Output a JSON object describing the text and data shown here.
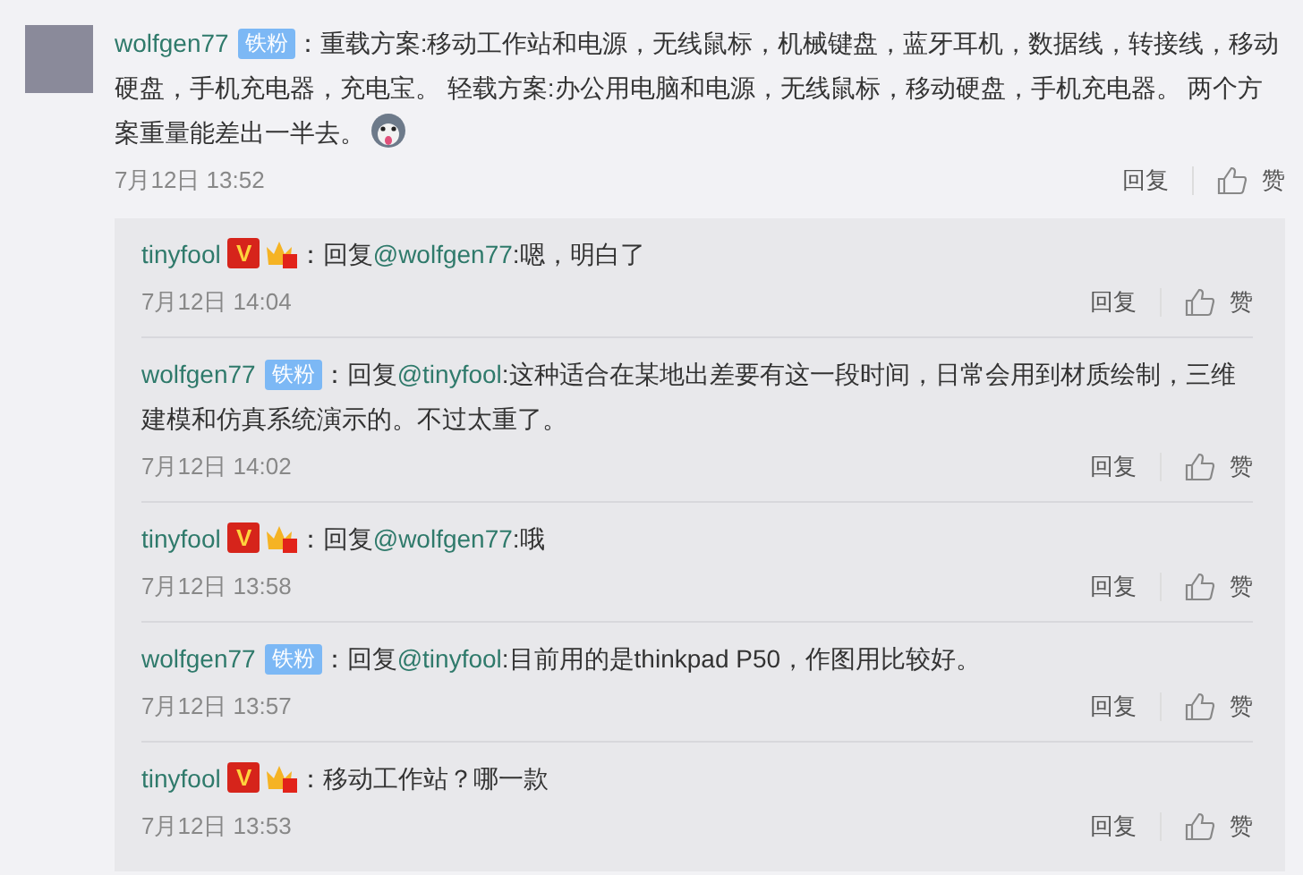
{
  "comment": {
    "user": "wolfgen77",
    "badges": [
      {
        "kind": "fan",
        "label": "铁粉"
      }
    ],
    "segments": [
      {
        "kind": "plain",
        "text": "：重载方案:移动工作站和电源，无线鼠标，机械键盘，蓝牙耳机，数据线，转接线，移动硬盘，手机充电器，充电宝。 轻载方案:办公用电脑和电源，无线鼠标，移动硬盘，手机充电器。 两个方案重量能差出一半去。"
      }
    ],
    "emoji": true,
    "time": "7月12日 13:52",
    "reply": "回复",
    "like": "赞"
  },
  "replies": [
    {
      "user": "tinyfool",
      "badges": [
        {
          "kind": "verified",
          "label": "V"
        },
        {
          "kind": "crown"
        }
      ],
      "segments": [
        {
          "kind": "plain",
          "text": "：回复"
        },
        {
          "kind": "mention",
          "text": "@wolfgen77"
        },
        {
          "kind": "plain",
          "text": ":嗯，明白了"
        }
      ],
      "time": "7月12日 14:04",
      "reply": "回复",
      "like": "赞"
    },
    {
      "user": "wolfgen77",
      "badges": [
        {
          "kind": "fan",
          "label": "铁粉"
        }
      ],
      "segments": [
        {
          "kind": "plain",
          "text": "：回复"
        },
        {
          "kind": "mention",
          "text": "@tinyfool"
        },
        {
          "kind": "plain",
          "text": ":这种适合在某地出差要有这一段时间，日常会用到材质绘制，三维建模和仿真系统演示的。不过太重了。"
        }
      ],
      "time": "7月12日 14:02",
      "reply": "回复",
      "like": "赞"
    },
    {
      "user": "tinyfool",
      "badges": [
        {
          "kind": "verified",
          "label": "V"
        },
        {
          "kind": "crown"
        }
      ],
      "segments": [
        {
          "kind": "plain",
          "text": "：回复"
        },
        {
          "kind": "mention",
          "text": "@wolfgen77"
        },
        {
          "kind": "plain",
          "text": ":哦"
        }
      ],
      "time": "7月12日 13:58",
      "reply": "回复",
      "like": "赞"
    },
    {
      "user": "wolfgen77",
      "badges": [
        {
          "kind": "fan",
          "label": "铁粉"
        }
      ],
      "segments": [
        {
          "kind": "plain",
          "text": "：回复"
        },
        {
          "kind": "mention",
          "text": "@tinyfool"
        },
        {
          "kind": "plain",
          "text": ":目前用的是thinkpad P50，作图用比较好。"
        }
      ],
      "time": "7月12日 13:57",
      "reply": "回复",
      "like": "赞"
    },
    {
      "user": "tinyfool",
      "badges": [
        {
          "kind": "verified",
          "label": "V"
        },
        {
          "kind": "crown"
        }
      ],
      "segments": [
        {
          "kind": "plain",
          "text": "：移动工作站？哪一款"
        }
      ],
      "time": "7月12日 13:53",
      "reply": "回复",
      "like": "赞"
    }
  ]
}
